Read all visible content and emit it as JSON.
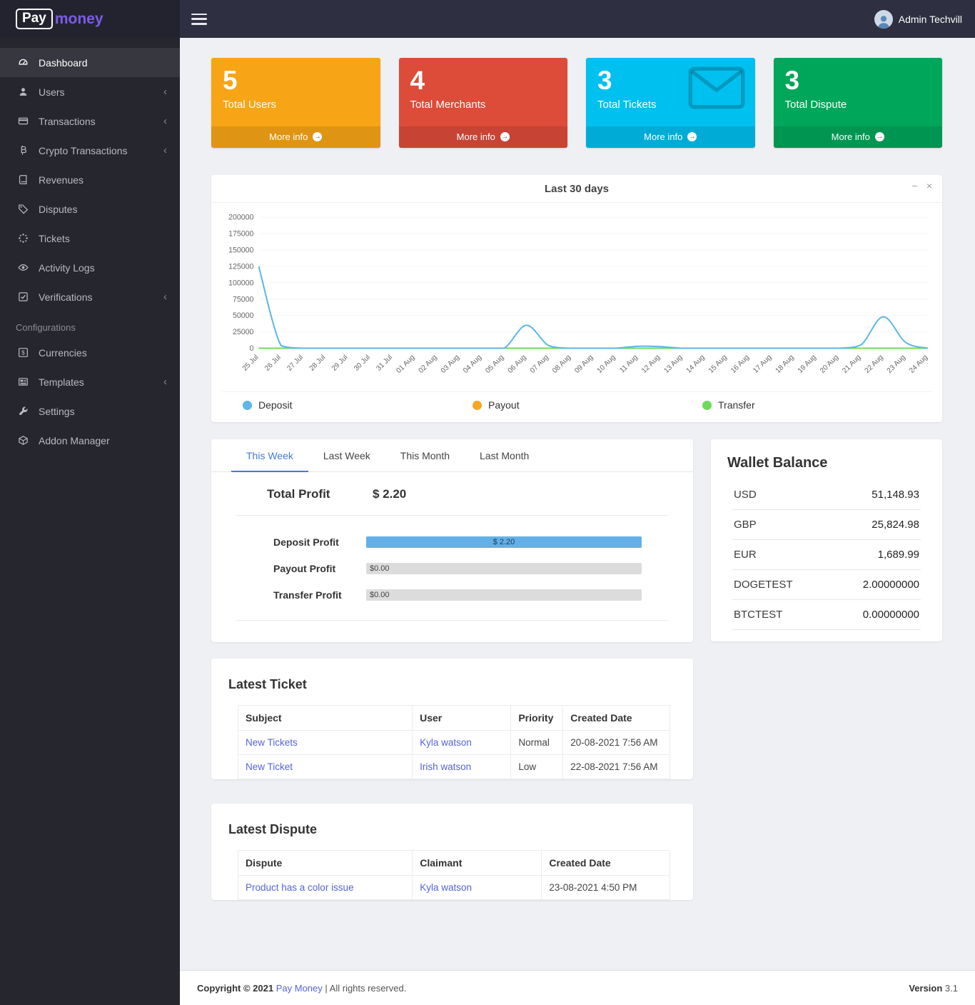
{
  "colors": {
    "brand": "#7c5ce6",
    "link": "#5464d8",
    "tabactive": "#4478dd"
  },
  "brand": {
    "pay": "Pay",
    "money": "money"
  },
  "topbar": {
    "admin_name": "Admin Techvill"
  },
  "sidebar": {
    "section_label": "Configurations",
    "items": [
      {
        "label": "Dashboard"
      },
      {
        "label": "Users"
      },
      {
        "label": "Transactions"
      },
      {
        "label": "Crypto Transactions"
      },
      {
        "label": "Revenues"
      },
      {
        "label": "Disputes"
      },
      {
        "label": "Tickets"
      },
      {
        "label": "Activity Logs"
      },
      {
        "label": "Verifications"
      },
      {
        "label": "Currencies"
      },
      {
        "label": "Templates"
      },
      {
        "label": "Settings"
      },
      {
        "label": "Addon Manager"
      }
    ]
  },
  "stats": [
    {
      "value": "5",
      "label": "Total Users",
      "more_label": "More info",
      "color": "#f7a516",
      "footer_color": "#df9413"
    },
    {
      "value": "4",
      "label": "Total Merchants",
      "more_label": "More info",
      "color": "#dd4b39",
      "footer_color": "#c74334"
    },
    {
      "value": "3",
      "label": "Total Tickets",
      "more_label": "More info",
      "color": "#00c0ef",
      "footer_color": "#00acd6"
    },
    {
      "value": "3",
      "label": "Total Dispute",
      "more_label": "More info",
      "color": "#00a65a",
      "footer_color": "#009551"
    }
  ],
  "chart_card": {
    "collapse": "−",
    "close": "×"
  },
  "chart_data": {
    "type": "line",
    "title": "Last 30 days",
    "x": [
      "25 Jul",
      "26 Jul",
      "27 Jul",
      "28 Jul",
      "29 Jul",
      "30 Jul",
      "31 Jul",
      "01 Aug",
      "02 Aug",
      "03 Aug",
      "04 Aug",
      "05 Aug",
      "06 Aug",
      "07 Aug",
      "08 Aug",
      "09 Aug",
      "10 Aug",
      "11 Aug",
      "12 Aug",
      "13 Aug",
      "14 Aug",
      "15 Aug",
      "16 Aug",
      "17 Aug",
      "18 Aug",
      "19 Aug",
      "20 Aug",
      "21 Aug",
      "22 Aug",
      "23 Aug",
      "24 Aug"
    ],
    "series": [
      {
        "name": "Deposit",
        "color": "#5eb6ea",
        "values": [
          125000,
          4000,
          0,
          0,
          0,
          0,
          0,
          0,
          0,
          0,
          0,
          0,
          35000,
          4000,
          0,
          0,
          0,
          3000,
          2500,
          0,
          0,
          0,
          0,
          0,
          0,
          0,
          0,
          5000,
          48000,
          9000,
          0
        ]
      },
      {
        "name": "Payout",
        "color": "#f5a623",
        "values": [
          0,
          0,
          0,
          0,
          0,
          0,
          0,
          0,
          0,
          0,
          0,
          0,
          0,
          0,
          0,
          0,
          0,
          0,
          0,
          0,
          0,
          0,
          0,
          0,
          0,
          0,
          0,
          0,
          0,
          0,
          0
        ]
      },
      {
        "name": "Transfer",
        "color": "#6ddb5a",
        "values": [
          0,
          0,
          0,
          0,
          0,
          0,
          0,
          0,
          0,
          0,
          0,
          0,
          0,
          0,
          0,
          0,
          0,
          0,
          0,
          0,
          0,
          0,
          0,
          0,
          0,
          0,
          0,
          0,
          0,
          0,
          0
        ]
      }
    ],
    "ylim": [
      0,
      200000
    ],
    "yticks": [
      0,
      25000,
      50000,
      75000,
      100000,
      125000,
      150000,
      175000,
      200000
    ],
    "grid": true,
    "legend_position": "bottom"
  },
  "profit": {
    "tabs": [
      "This Week",
      "Last Week",
      "This Month",
      "Last Month"
    ],
    "active_tab": "This Week",
    "total_label": "Total Profit",
    "total_value": "$ 2.20",
    "rows": [
      {
        "label": "Deposit Profit",
        "value": "$ 2.20",
        "pct": 100,
        "bar_color": "#64b0e6"
      },
      {
        "label": "Payout Profit",
        "value": "$0.00",
        "pct": 0,
        "bar_color": "#dcdcdc"
      },
      {
        "label": "Transfer Profit",
        "value": "$0.00",
        "pct": 0,
        "bar_color": "#dcdcdc"
      }
    ]
  },
  "wallet": {
    "title": "Wallet Balance",
    "rows": [
      {
        "currency": "USD",
        "amount": "51,148.93"
      },
      {
        "currency": "GBP",
        "amount": "25,824.98"
      },
      {
        "currency": "EUR",
        "amount": "1,689.99"
      },
      {
        "currency": "DOGETEST",
        "amount": "2.00000000"
      },
      {
        "currency": "BTCTEST",
        "amount": "0.00000000"
      }
    ]
  },
  "latest_ticket": {
    "title": "Latest Ticket",
    "headers": [
      "Subject",
      "User",
      "Priority",
      "Created Date"
    ],
    "rows": [
      {
        "subject": "New Tickets",
        "user": "Kyla watson",
        "priority": "Normal",
        "created": "20-08-2021 7:56 AM"
      },
      {
        "subject": "New Ticket",
        "user": "Irish watson",
        "priority": "Low",
        "created": "22-08-2021 7:56 AM"
      }
    ]
  },
  "latest_dispute": {
    "title": "Latest Dispute",
    "headers": [
      "Dispute",
      "Claimant",
      "Created Date"
    ],
    "rows": [
      {
        "dispute": "Product has a color issue",
        "claimant": "Kyla watson",
        "created": "23-08-2021 4:50 PM"
      }
    ]
  },
  "footer": {
    "copyright": "Copyright © 2021",
    "brand": "Pay Money",
    "rights": "| All rights reserved.",
    "version_label": "Version",
    "version": "3.1"
  }
}
